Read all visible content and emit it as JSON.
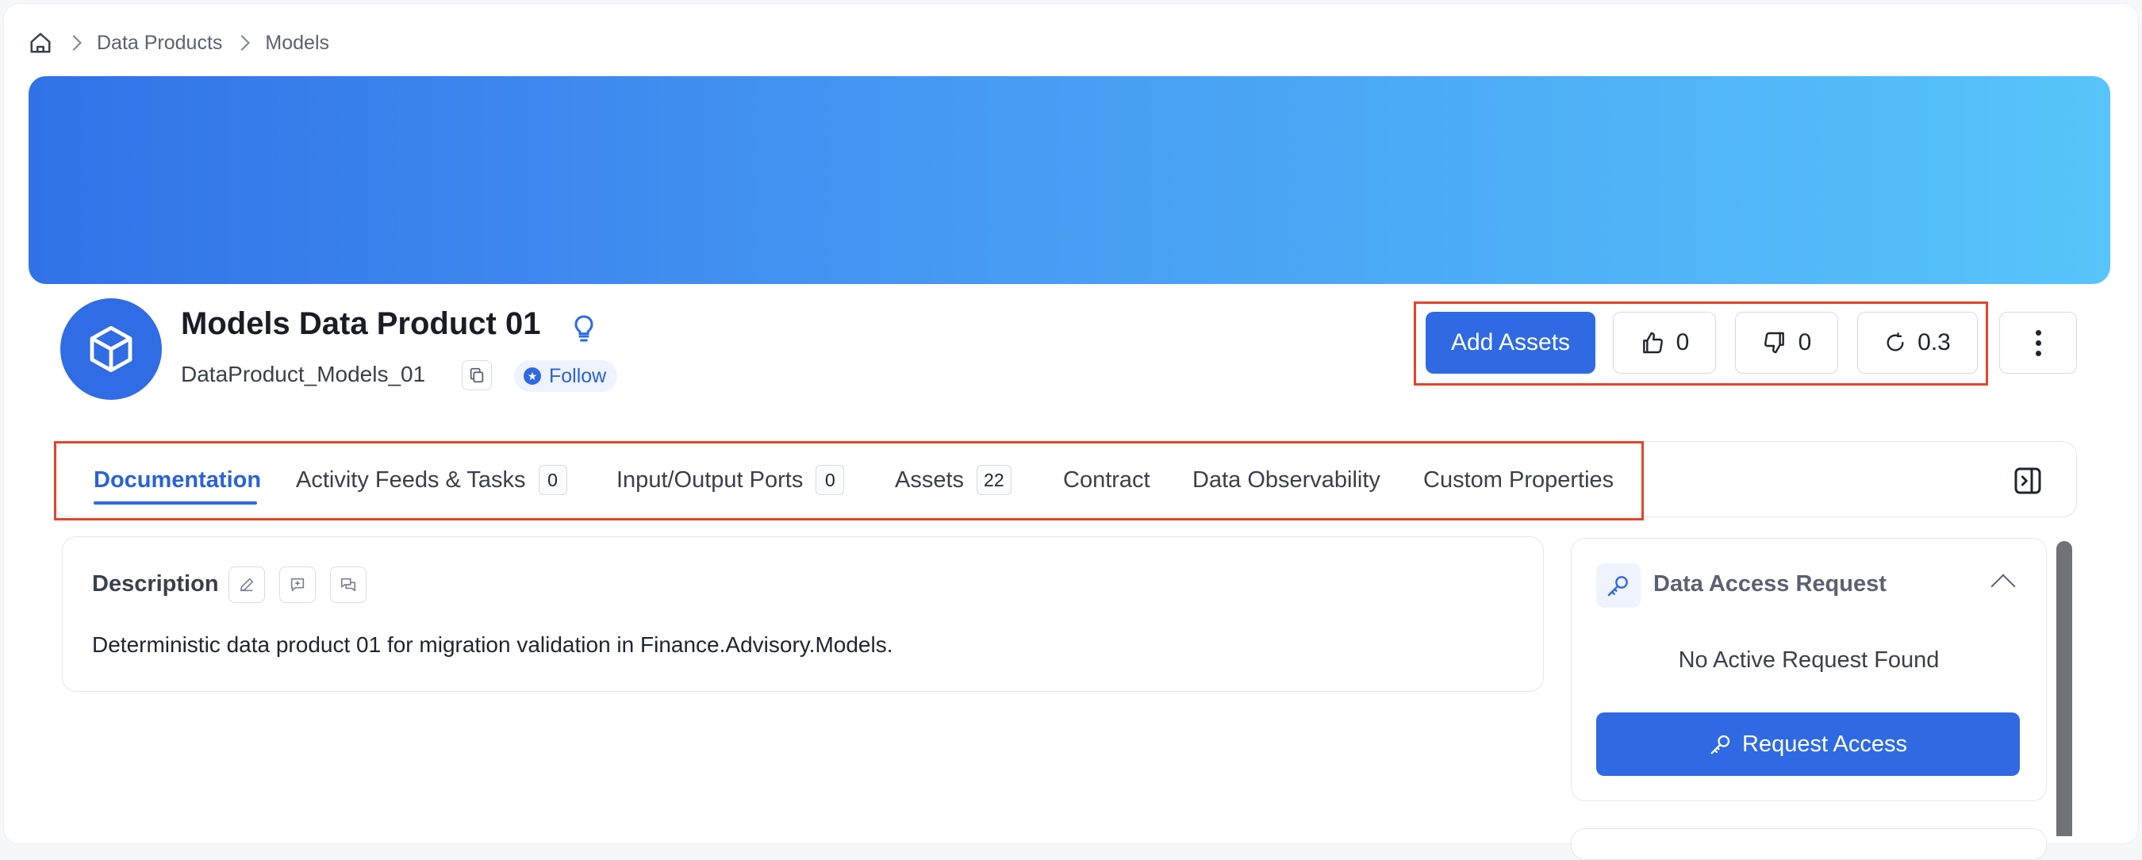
{
  "breadcrumb": {
    "items": [
      "Data Products",
      "Models"
    ]
  },
  "header": {
    "title": "Models Data Product 01",
    "subtitle": "DataProduct_Models_01",
    "follow_label": "Follow"
  },
  "actions": {
    "add_assets_label": "Add Assets",
    "likes": "0",
    "dislikes": "0",
    "version": "0.3"
  },
  "tabs": [
    {
      "label": "Documentation",
      "count": null
    },
    {
      "label": "Activity Feeds & Tasks",
      "count": "0"
    },
    {
      "label": "Input/Output Ports",
      "count": "0"
    },
    {
      "label": "Assets",
      "count": "22"
    },
    {
      "label": "Contract",
      "count": null
    },
    {
      "label": "Data Observability",
      "count": null
    },
    {
      "label": "Custom Properties",
      "count": null
    }
  ],
  "description": {
    "label": "Description",
    "text": "Deterministic data product 01 for migration validation in Finance.Advisory.Models."
  },
  "access": {
    "title": "Data Access Request",
    "empty_text": "No Active Request Found",
    "request_label": "Request Access"
  },
  "colors": {
    "accent": "#2f6ae3",
    "highlight": "#e0452b",
    "banner_start": "#3172e8",
    "banner_end": "#57c4fa"
  }
}
